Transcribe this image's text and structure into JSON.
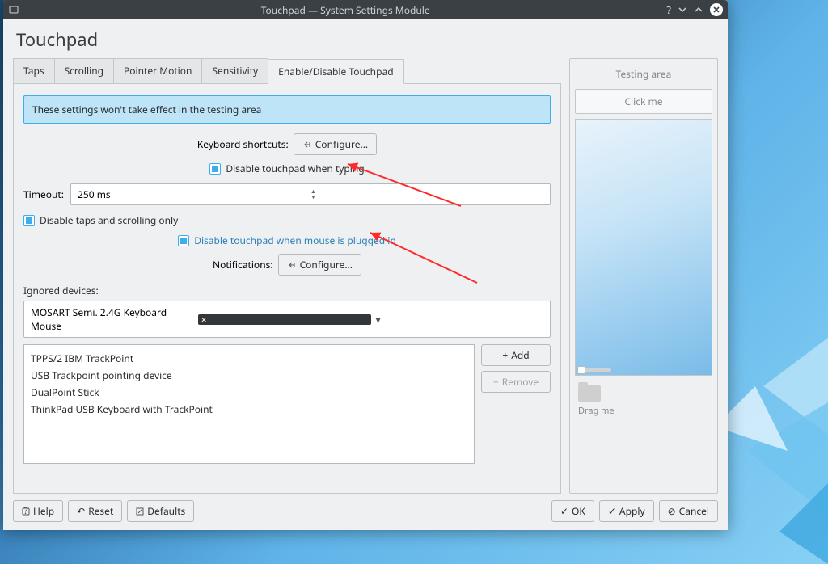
{
  "window": {
    "title": "Touchpad — System Settings Module"
  },
  "page_title": "Touchpad",
  "tabs": [
    "Taps",
    "Scrolling",
    "Pointer Motion",
    "Sensitivity",
    "Enable/Disable Touchpad"
  ],
  "active_tab": 4,
  "banner": "These settings won't take effect in the testing area",
  "labels": {
    "keyboard_shortcuts": "Keyboard shortcuts:",
    "configure": "Configure...",
    "disable_typing": "Disable touchpad when typing",
    "timeout": "Timeout:",
    "timeout_value": "250 ms",
    "disable_taps_scroll": "Disable taps and scrolling only",
    "disable_mouse": "Disable touchpad when mouse is plugged in",
    "notifications": "Notifications:",
    "ignored_devices": "Ignored devices:",
    "selected_device": "MOSART Semi. 2.4G Keyboard Mouse",
    "add": "Add",
    "remove": "Remove"
  },
  "device_list": [
    "TPPS/2 IBM TrackPoint",
    "USB Trackpoint pointing device",
    "DualPoint Stick",
    "ThinkPad USB Keyboard with TrackPoint"
  ],
  "side": {
    "title": "Testing area",
    "clickme": "Click me",
    "dragme": "Drag me"
  },
  "footer": {
    "help": "Help",
    "reset": "Reset",
    "defaults": "Defaults",
    "ok": "OK",
    "apply": "Apply",
    "cancel": "Cancel"
  }
}
